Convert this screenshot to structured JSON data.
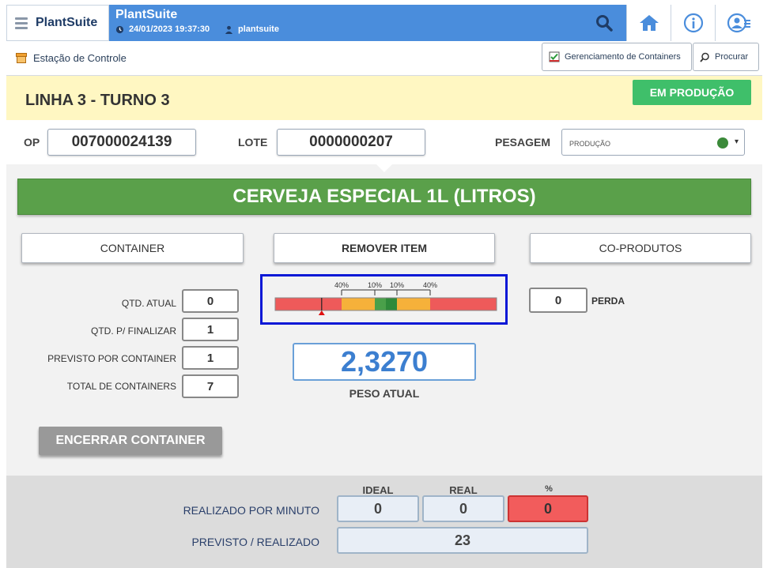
{
  "header": {
    "brand": "PlantSuite",
    "app_title": "PlantSuite",
    "datetime": "24/01/2023 19:37:30",
    "user": "plantsuite"
  },
  "nav": {
    "station": "Estação de Controle",
    "containers_btn": "Gerenciamento de Containers",
    "search_btn": "Procurar"
  },
  "line": {
    "title": "LINHA 3 - TURNO 3",
    "status": "EM PRODUÇÃO"
  },
  "fields": {
    "op_label": "OP",
    "op_value": "007000024139",
    "lote_label": "LOTE",
    "lote_value": "0000000207",
    "pesagem_label": "PESAGEM",
    "pesagem_value": "PRODUÇÃO"
  },
  "product": "CERVEJA ESPECIAL 1L (LITROS)",
  "buttons": {
    "container": "CONTAINER",
    "remover": "REMOVER ITEM",
    "coprodutos": "CO-PRODUTOS",
    "encerrar": "ENCERRAR CONTAINER"
  },
  "summary": [
    {
      "label": "QTD. ATUAL",
      "value": "0"
    },
    {
      "label": "QTD. P/ FINALIZAR",
      "value": "1"
    },
    {
      "label": "PREVISTO POR CONTAINER",
      "value": "1"
    },
    {
      "label": "TOTAL DE CONTAINERS",
      "value": "7"
    }
  ],
  "gauge": {
    "tick_labels": [
      "40%",
      "10%",
      "10%",
      "40%"
    ],
    "marker_fraction": 0.21,
    "colors": {
      "red": "#ee5a5a",
      "orange": "#f6b13a",
      "green": "#4aa04a",
      "dark_green": "#2f8a3a"
    }
  },
  "peso": {
    "value": "2,3270",
    "label": "PESO ATUAL"
  },
  "perda": {
    "value": "0",
    "label": "PERDA"
  },
  "stats": {
    "headers": [
      "IDEAL",
      "REAL",
      "%"
    ],
    "rows": [
      {
        "label": "REALIZADO POR MINUTO",
        "ideal": "0",
        "real": "0",
        "pct": "0"
      },
      {
        "label": "PREVISTO / REALIZADO",
        "value": "23"
      }
    ]
  }
}
